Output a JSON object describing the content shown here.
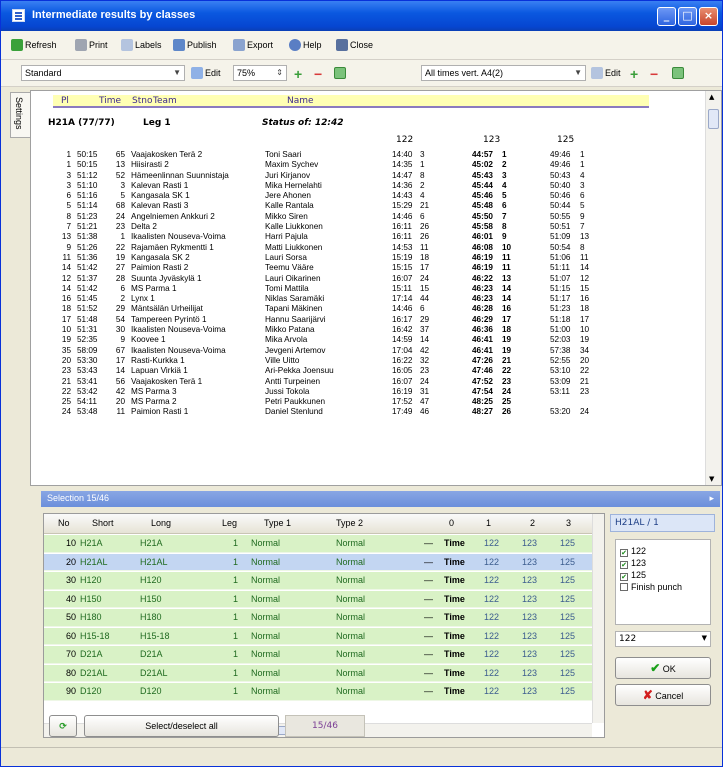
{
  "window": {
    "title": "Intermediate results by classes"
  },
  "toolbar": {
    "refresh": "Refresh",
    "print": "Print",
    "labels": "Labels",
    "publish": "Publish",
    "export": "Export",
    "help": "Help",
    "close": "Close"
  },
  "toolbar2": {
    "layout": "Standard",
    "edit": "Edit",
    "zoom": "75%",
    "times_layout": "All times vert. A4(2)",
    "edit2": "Edit"
  },
  "side_tab": "Settings",
  "results": {
    "headers": {
      "pl": "Pl",
      "time": "Time",
      "stno": "Stno",
      "team": "Team",
      "name": "Name"
    },
    "class_line": {
      "class": "H21A  (77/77)",
      "leg": "Leg  1",
      "status": "Status of: 12:42"
    },
    "controls": [
      "122",
      "123",
      "125"
    ],
    "rows": [
      [
        "1",
        "50:15",
        "65",
        "Vaajakosken Terä 2",
        "Toni Saari",
        "14:40",
        "3",
        "44:57",
        "1",
        "49:46",
        "1"
      ],
      [
        "1",
        "50:15",
        "13",
        "Hiisirasti 2",
        "Maxim Sychev",
        "14:35",
        "1",
        "45:02",
        "2",
        "49:46",
        "1"
      ],
      [
        "3",
        "51:12",
        "52",
        "Hämeenlinnan Suunnistaja",
        "Juri Kirjanov",
        "14:47",
        "8",
        "45:43",
        "3",
        "50:43",
        "4"
      ],
      [
        "3",
        "51:10",
        "3",
        "Kalevan Rasti 1",
        "Mika Hernelahti",
        "14:36",
        "2",
        "45:44",
        "4",
        "50:40",
        "3"
      ],
      [
        "6",
        "51:16",
        "5",
        "Kangasala SK 1",
        "Jere Ahonen",
        "14:43",
        "4",
        "45:46",
        "5",
        "50:46",
        "6"
      ],
      [
        "5",
        "51:14",
        "68",
        "Kalevan Rasti 3",
        "Kalle Rantala",
        "15:29",
        "21",
        "45:48",
        "6",
        "50:44",
        "5"
      ],
      [
        "8",
        "51:23",
        "24",
        "Angelniemen Ankkuri 2",
        "Mikko Siren",
        "14:46",
        "6",
        "45:50",
        "7",
        "50:55",
        "9"
      ],
      [
        "7",
        "51:21",
        "23",
        "Delta 2",
        "Kalle Liukkonen",
        "16:11",
        "26",
        "45:58",
        "8",
        "50:51",
        "7"
      ],
      [
        "13",
        "51:38",
        "1",
        "Ikaalisten Nouseva-Voima",
        "Harri Pajula",
        "16:11",
        "26",
        "46:01",
        "9",
        "51:09",
        "13"
      ],
      [
        "9",
        "51:26",
        "22",
        "Rajamäen Rykmentti 1",
        "Matti Liukkonen",
        "14:53",
        "11",
        "46:08",
        "10",
        "50:54",
        "8"
      ],
      [
        "11",
        "51:36",
        "19",
        "Kangasala SK 2",
        "Lauri Sorsa",
        "15:19",
        "18",
        "46:19",
        "11",
        "51:06",
        "11"
      ],
      [
        "14",
        "51:42",
        "27",
        "Paimion Rasti 2",
        "Teemu Vääre",
        "15:15",
        "17",
        "46:19",
        "11",
        "51:11",
        "14"
      ],
      [
        "12",
        "51:37",
        "28",
        "Suunta Jyväskylä 1",
        "Lauri Oikarinen",
        "16:07",
        "24",
        "46:22",
        "13",
        "51:07",
        "12"
      ],
      [
        "14",
        "51:42",
        "6",
        "MS Parma 1",
        "Tomi Mattila",
        "15:11",
        "15",
        "46:23",
        "14",
        "51:15",
        "15"
      ],
      [
        "16",
        "51:45",
        "2",
        "Lynx 1",
        "Niklas Saramäki",
        "17:14",
        "44",
        "46:23",
        "14",
        "51:17",
        "16"
      ],
      [
        "18",
        "51:52",
        "29",
        "Mäntsälän Urheilijat",
        "Tapani Mäkinen",
        "14:46",
        "6",
        "46:28",
        "16",
        "51:23",
        "18"
      ],
      [
        "17",
        "51:48",
        "54",
        "Tampereen Pyrintö 1",
        "Hannu Saarijärvi",
        "16:17",
        "29",
        "46:29",
        "17",
        "51:18",
        "17"
      ],
      [
        "10",
        "51:31",
        "30",
        "Ikaalisten Nouseva-Voima",
        "Mikko Patana",
        "16:42",
        "37",
        "46:36",
        "18",
        "51:00",
        "10"
      ],
      [
        "19",
        "52:35",
        "9",
        "Koovee 1",
        "Mika Arvola",
        "14:59",
        "14",
        "46:41",
        "19",
        "52:03",
        "19"
      ],
      [
        "35",
        "58:09",
        "67",
        "Ikaalisten Nouseva-Voima",
        "Jevgeni Artemov",
        "17:04",
        "42",
        "46:41",
        "19",
        "57:38",
        "34"
      ],
      [
        "20",
        "53:30",
        "17",
        "Rasti-Kurkka 1",
        "Ville Uitto",
        "16:22",
        "32",
        "47:26",
        "21",
        "52:55",
        "20"
      ],
      [
        "23",
        "53:43",
        "14",
        "Lapuan Virkiä 1",
        "Ari-Pekka Joensuu",
        "16:05",
        "23",
        "47:46",
        "22",
        "53:10",
        "22"
      ],
      [
        "21",
        "53:41",
        "56",
        "Vaajakosken Terä 1",
        "Antti Turpeinen",
        "16:07",
        "24",
        "47:52",
        "23",
        "53:09",
        "21"
      ],
      [
        "22",
        "53:42",
        "42",
        "MS Parma 3",
        "Jussi Tokola",
        "16:19",
        "31",
        "47:54",
        "24",
        "53:11",
        "23"
      ],
      [
        "25",
        "54:11",
        "20",
        "MS Parma 2",
        "Petri Paukkunen",
        "17:52",
        "47",
        "48:25",
        "25",
        "",
        ""
      ],
      [
        "24",
        "53:48",
        "11",
        "Paimion Rasti 1",
        "Daniel Stenlund",
        "17:49",
        "46",
        "48:27",
        "26",
        "53:20",
        "24"
      ]
    ]
  },
  "selection": {
    "title": "Selection  15/46",
    "headers": [
      "No",
      "Short",
      "Long",
      "Leg",
      "Type 1",
      "Type 2",
      "0",
      "1",
      "2",
      "3"
    ],
    "rows": [
      [
        "10",
        "H21A",
        "H21A",
        "1",
        "Normal",
        "Normal",
        "Time",
        "122",
        "123",
        "125"
      ],
      [
        "20",
        "H21AL",
        "H21AL",
        "1",
        "Normal",
        "Normal",
        "Time",
        "122",
        "123",
        "125"
      ],
      [
        "30",
        "H120",
        "H120",
        "1",
        "Normal",
        "Normal",
        "Time",
        "122",
        "123",
        "125"
      ],
      [
        "40",
        "H150",
        "H150",
        "1",
        "Normal",
        "Normal",
        "Time",
        "122",
        "123",
        "125"
      ],
      [
        "50",
        "H180",
        "H180",
        "1",
        "Normal",
        "Normal",
        "Time",
        "122",
        "123",
        "125"
      ],
      [
        "60",
        "H15-18",
        "H15-18",
        "1",
        "Normal",
        "Normal",
        "Time",
        "122",
        "123",
        "125"
      ],
      [
        "70",
        "D21A",
        "D21A",
        "1",
        "Normal",
        "Normal",
        "Time",
        "122",
        "123",
        "125"
      ],
      [
        "80",
        "D21AL",
        "D21AL",
        "1",
        "Normal",
        "Normal",
        "Time",
        "122",
        "123",
        "125"
      ],
      [
        "90",
        "D120",
        "D120",
        "1",
        "Normal",
        "Normal",
        "Time",
        "122",
        "123",
        "125"
      ]
    ]
  },
  "right_panel": {
    "title": "H21AL / 1",
    "checks": [
      {
        "label": "122",
        "checked": true
      },
      {
        "label": "123",
        "checked": true
      },
      {
        "label": "125",
        "checked": true
      },
      {
        "label": "Finish punch",
        "checked": false
      }
    ],
    "combo": "122",
    "ok": "OK",
    "cancel": "Cancel"
  },
  "bottom": {
    "select_all": "Select/deselect all",
    "count": "15/46"
  }
}
